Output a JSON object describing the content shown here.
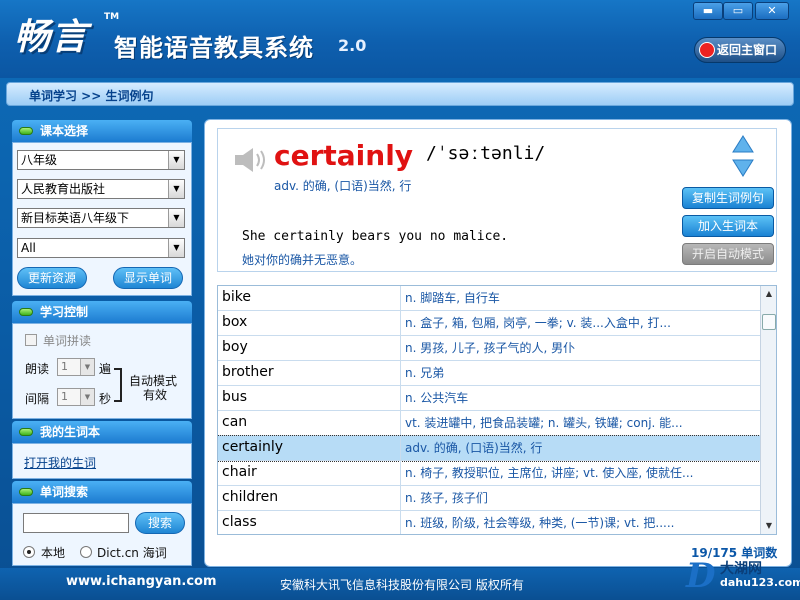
{
  "app": {
    "logo": "畅言",
    "trademark": "TM",
    "subtitle": "智能语音教具系统",
    "version": "2.0",
    "home_button": "返回主窗口"
  },
  "window_buttons": {
    "minimize": "▬",
    "maximize": "▭",
    "close": "✕"
  },
  "breadcrumb": "单词学习 >> 生词例句",
  "textbook": {
    "header": "课本选择",
    "grade": "八年级",
    "publisher": "人民教育出版社",
    "book": "新目标英语八年级下",
    "unit": "All",
    "update_button": "更新资源",
    "show_button": "显示单词"
  },
  "learning": {
    "header": "学习控制",
    "spell_label": "单词拼读",
    "read_label": "朗读",
    "read_value": "1",
    "read_unit": "遍",
    "interval_label": "间隔",
    "interval_value": "1",
    "interval_unit": "秒",
    "auto_note_1": "自动模式",
    "auto_note_2": "有效"
  },
  "vocab": {
    "header": "我的生词本",
    "open_link": "打开我的生词"
  },
  "search": {
    "header": "单词搜索",
    "input_value": "",
    "button": "搜索",
    "opt_local": "本地",
    "opt_dict": "Dict.cn 海词"
  },
  "word_card": {
    "word": "certainly",
    "phonetic": "/ˈsəːtənli/",
    "meaning": "adv. 的确, (口语)当然, 行",
    "example_en": "She certainly bears you no malice.",
    "example_cn": "她对你的确并无恶意。",
    "copy_button": "复制生词例句",
    "add_button": "加入生词本",
    "auto_button": "开启自动模式"
  },
  "words": [
    {
      "word": "bike",
      "meaning": "n. 脚踏车, 自行车"
    },
    {
      "word": "box",
      "meaning": "n. 盒子, 箱, 包厢, 岗亭, 一拳; v. 装...入盒中, 打..."
    },
    {
      "word": "boy",
      "meaning": "n. 男孩, 儿子, 孩子气的人, 男仆"
    },
    {
      "word": "brother",
      "meaning": "n. 兄弟"
    },
    {
      "word": "bus",
      "meaning": "n. 公共汽车"
    },
    {
      "word": "can",
      "meaning": "vt. 装进罐中, 把食品装罐; n. 罐头, 铁罐; conj. 能..."
    },
    {
      "word": "certainly",
      "meaning": "adv. 的确, (口语)当然, 行"
    },
    {
      "word": "chair",
      "meaning": "n. 椅子, 教授职位, 主席位, 讲座; vt. 使入座, 使就任..."
    },
    {
      "word": "children",
      "meaning": "n. 孩子, 孩子们"
    },
    {
      "word": "class",
      "meaning": "n. 班级, 阶级, 社会等级, 种类, (一节)课; vt. 把....."
    }
  ],
  "word_count": "19/175 单词数",
  "footer": {
    "site": "www.ichangyan.com",
    "copyright": "安徽科大讯飞信息科技股份有限公司 版权所有"
  },
  "watermark": {
    "letter": "D",
    "name": "大湖网",
    "url": "dahu123.com"
  },
  "colors": {
    "accent": "#1a82d3",
    "word_red": "#e01212",
    "selected_row": "#b7dcf6"
  }
}
